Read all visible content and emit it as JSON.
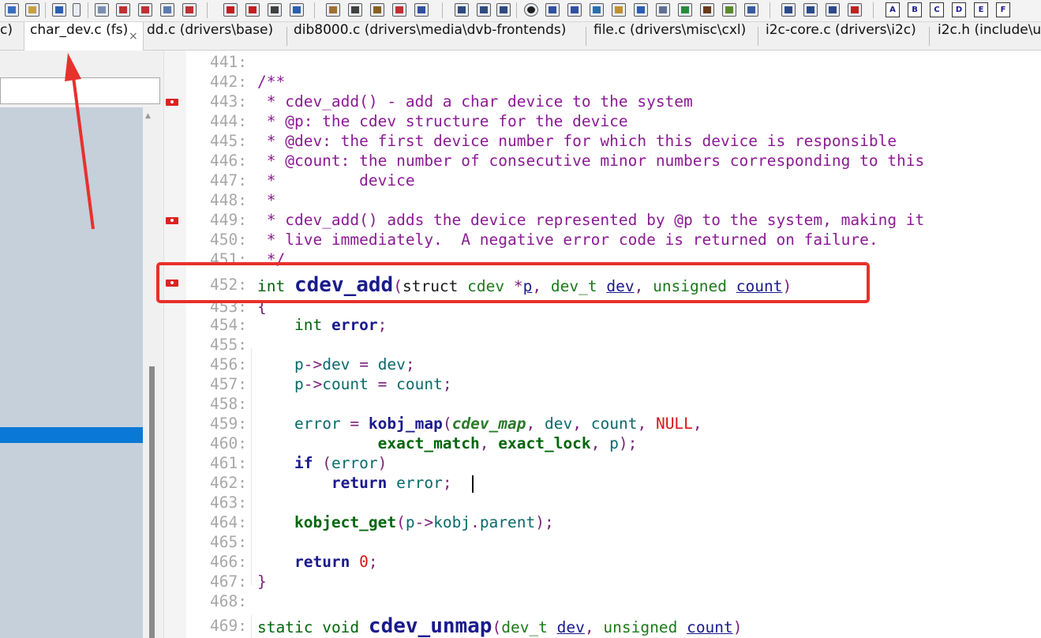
{
  "tabs": [
    {
      "label": "c)",
      "active": false
    },
    {
      "label": "char_dev.c (fs)",
      "active": true,
      "close": "×"
    },
    {
      "label": "dd.c (drivers\\base)",
      "active": false
    },
    {
      "label": "dib8000.c (drivers\\media\\dvb-frontends)",
      "active": false
    },
    {
      "label": "file.c (drivers\\misc\\cxl)",
      "active": false
    },
    {
      "label": "i2c-core.c (drivers\\i2c)",
      "active": false
    },
    {
      "label": "i2c.h (include\\u",
      "active": false
    }
  ],
  "toolbar": {
    "letter_buttons": [
      "A",
      "B",
      "C",
      "D",
      "E",
      "F"
    ]
  },
  "editor": {
    "lines": [
      {
        "n": "441:",
        "text": ""
      },
      {
        "n": "442:",
        "text": "/**"
      },
      {
        "n": "443:",
        "text": " * cdev_add() - add a char device to the system"
      },
      {
        "n": "444:",
        "text": " * @p: the cdev structure for the device"
      },
      {
        "n": "445:",
        "text": " * @dev: the first device number for which this device is responsible"
      },
      {
        "n": "446:",
        "text": " * @count: the number of consecutive minor numbers corresponding to this"
      },
      {
        "n": "447:",
        "text": " *         device"
      },
      {
        "n": "448:",
        "text": " *"
      },
      {
        "n": "449:",
        "text": " * cdev_add() adds the device represented by @p to the system, making it"
      },
      {
        "n": "450:",
        "text": " * live immediately.  A negative error code is returned on failure."
      },
      {
        "n": "451:",
        "text": " */"
      },
      {
        "n": "452:",
        "text": "int cdev_add(struct cdev *p, dev_t dev, unsigned count)"
      },
      {
        "n": "453:",
        "text": "{"
      },
      {
        "n": "454:",
        "text": "    int error;"
      },
      {
        "n": "455:",
        "text": ""
      },
      {
        "n": "456:",
        "text": "    p->dev = dev;"
      },
      {
        "n": "457:",
        "text": "    p->count = count;"
      },
      {
        "n": "458:",
        "text": ""
      },
      {
        "n": "459:",
        "text": "    error = kobj_map(cdev_map, dev, count, NULL,"
      },
      {
        "n": "460:",
        "text": "             exact_match, exact_lock, p);"
      },
      {
        "n": "461:",
        "text": "    if (error)"
      },
      {
        "n": "462:",
        "text": "        return error;"
      },
      {
        "n": "463:",
        "text": ""
      },
      {
        "n": "464:",
        "text": "    kobject_get(p->kobj.parent);"
      },
      {
        "n": "465:",
        "text": ""
      },
      {
        "n": "466:",
        "text": "    return 0;"
      },
      {
        "n": "467:",
        "text": "}"
      },
      {
        "n": "468:",
        "text": ""
      },
      {
        "n": "469:",
        "text": "static void cdev_unmap(dev_t dev, unsigned count)"
      }
    ]
  },
  "colors": {
    "comment": "#8b1b93",
    "keyword": "#00660a",
    "function": "#1a1a8c",
    "number": "#d41818",
    "annotation": "#e8302c",
    "selection": "#0a78d6"
  }
}
